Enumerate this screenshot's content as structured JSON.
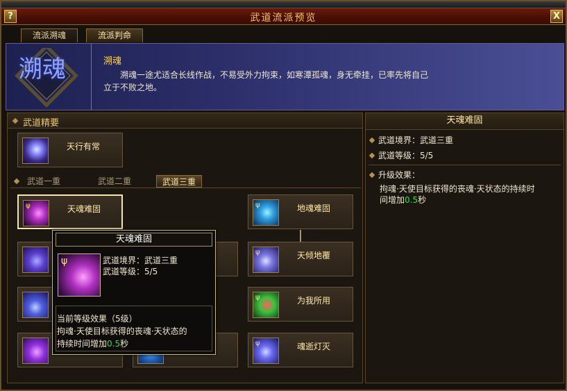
{
  "window": {
    "title": "武道流派预览",
    "help_label": "?",
    "close_label": "X"
  },
  "tabs": [
    {
      "label": "流派溯魂",
      "active": false
    },
    {
      "label": "流派判命",
      "active": true
    }
  ],
  "banner": {
    "emblem_text": "溯魂",
    "school_name": "溯魂",
    "description": "溯魂一途尤适合长线作战，不易受外力拘束，如寒潭孤魂，身无牵挂，已率先将自己立于不败之地。"
  },
  "essence": {
    "header": "武道精要",
    "skill_name": "天行有常"
  },
  "tiers": [
    {
      "label": "武道一重",
      "active": false
    },
    {
      "label": "武道二重",
      "active": false
    },
    {
      "label": "武道三重",
      "active": true
    }
  ],
  "skills": {
    "left_0": "天魂难固",
    "right_0": "地魂难固",
    "right_1": "天倾地覆",
    "right_2": "为我所用",
    "right_3": "魂逝灯灭"
  },
  "detail": {
    "title": "天魂难固",
    "realm": "武道境界：武道三重",
    "level": "武道等级：5/5",
    "upgrade_header": "升级效果：",
    "upgrade_text_1": "拘魂·天使目标获得的丧魂·天状态的持续时",
    "upgrade_text_2a": "间增加",
    "upgrade_value": "0.5",
    "upgrade_text_2b": "秒"
  },
  "tooltip": {
    "title": "天魂难固",
    "realm": "武道境界：武道三重",
    "level": "武道等级：5/5",
    "current_header": "当前等级效果（5级）",
    "effect_1": "拘魂·天使目标获得的丧魂·天状态的",
    "effect_2a": "持续时间增加",
    "effect_value": "0.5",
    "effect_2b": "秒"
  },
  "colors": {
    "title_gold": "#f2c460",
    "highlight_green": "#3cdc4c",
    "banner_blue": "#2c2f6a"
  },
  "icons": [
    "help-icon",
    "close-icon",
    "school-emblem-icon",
    "skill-icon",
    "diamond-bullet-icon"
  ]
}
